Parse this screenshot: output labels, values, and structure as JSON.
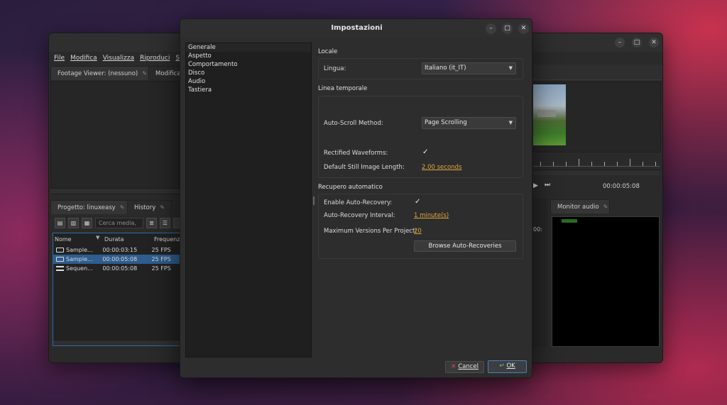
{
  "main_window": {
    "menu": [
      "File",
      "Modifica",
      "Visualizza",
      "Riproduci",
      "Seq"
    ],
    "footage_tab": "Footage Viewer: (nessuno)",
    "modify_tab": "Modifica",
    "project_tab": "Progetto: linuxeasy",
    "history_tab": "History",
    "search_placeholder": "Cerca media, ...",
    "columns": [
      "Nome",
      "Durata",
      "Frequenza"
    ],
    "rows": [
      {
        "name": "Sample...",
        "duration": "00:00:03:15",
        "fps": "25 FPS",
        "icon": "video-icon",
        "selected": false
      },
      {
        "name": "Sample...",
        "duration": "00:00:05:08",
        "fps": "25 FPS",
        "icon": "video-icon",
        "selected": true
      },
      {
        "name": "Sequen...",
        "duration": "00:00:05:08",
        "fps": "25 FPS",
        "icon": "sequence-icon",
        "selected": false
      }
    ],
    "timecode": "00:00:05:08",
    "partial_timecode": "00:",
    "monitor_audio_tab": "Monitor audio"
  },
  "dialog": {
    "title": "Impostazioni",
    "nav_items": [
      "Generale",
      "Aspetto",
      "Comportamento",
      "Disco",
      "Audio",
      "Tastiera"
    ],
    "selected_nav": "Generale",
    "locale": {
      "section": "Locale",
      "language_label": "Lingua:",
      "language_value": "Italiano (it_IT)"
    },
    "timeline": {
      "section": "Linea temporale",
      "autoscroll_label": "Auto-Scroll Method:",
      "autoscroll_value": "Page Scrolling",
      "rectified_label": "Rectified Waveforms:",
      "rectified_checked": true,
      "still_label": "Default Still Image Length:",
      "still_value": "2.00 seconds"
    },
    "recovery": {
      "section": "Recupero automatico",
      "enable_label": "Enable Auto-Recovery:",
      "enable_checked": true,
      "interval_label": "Auto-Recovery Interval:",
      "interval_value": "1 minute(s)",
      "max_label": "Maximum Versions Per Project:",
      "max_value": "20",
      "browse_button": "Browse Auto-Recoveries"
    },
    "cancel_button": "Cancel",
    "ok_button": "OK"
  },
  "colors": {
    "accent_link": "#e0a640",
    "selection": "#2e5d8e",
    "cancel_icon": "#d04848",
    "ok_icon": "#7fbf5f"
  }
}
